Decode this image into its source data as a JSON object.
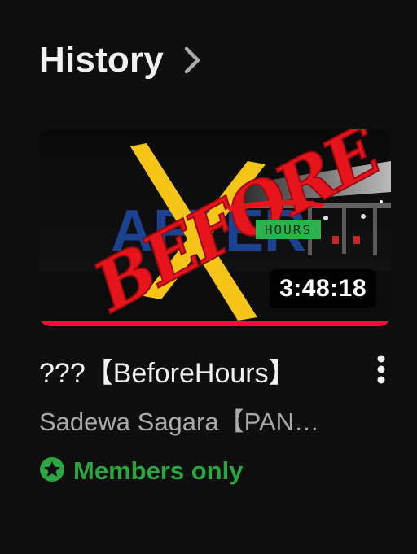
{
  "header": {
    "title": "History",
    "chevron_icon": "chevron-right-icon"
  },
  "video": {
    "thumbnail": {
      "main_text": "BEFORE",
      "tag_text": "HOURS",
      "bg_text": "AFTER",
      "duration": "3:48:18",
      "progress": 1.0,
      "colors": {
        "main_text": "#e8141c",
        "x_mark": "#f5c518",
        "tag_bg": "#2bb24c",
        "bg_text": "#1f4aa8"
      }
    },
    "title": "???【BeforeHours】",
    "channel": "Sadewa Sagara【PAN…",
    "badge": {
      "icon": "star-circle-icon",
      "label": "Members only",
      "color": "#2ba640"
    },
    "menu_icon": "more-vertical-icon"
  },
  "colors": {
    "background": "#0f0f0f",
    "progress": "#ff0a3c"
  }
}
